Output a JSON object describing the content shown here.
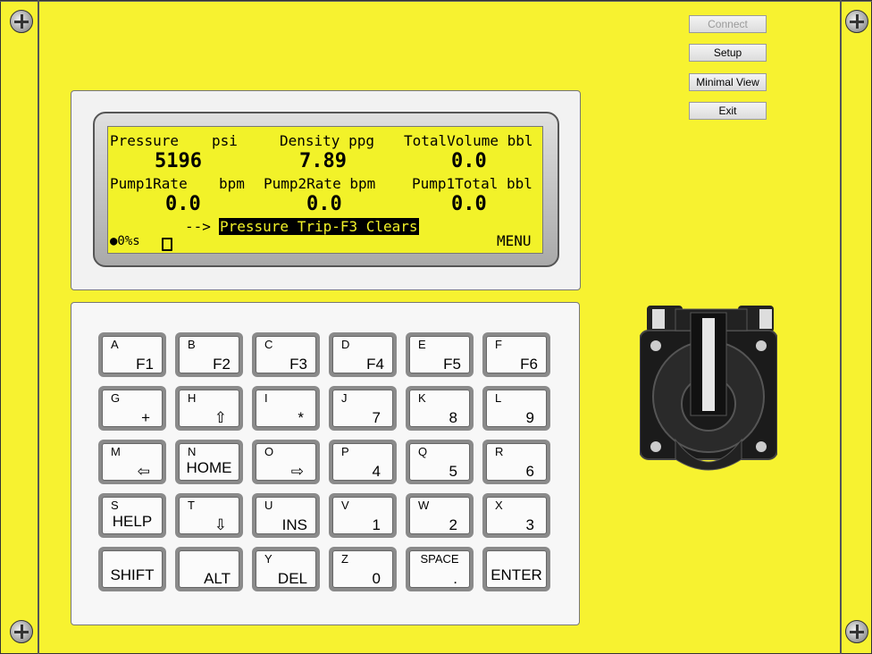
{
  "buttons": {
    "connect": "Connect",
    "setup": "Setup",
    "minimal_view": "Minimal View",
    "exit": "Exit"
  },
  "lcd": {
    "row1_labels": [
      "Pressure",
      "psi",
      "Density ppg",
      "TotalVolume bbl"
    ],
    "row1_values": [
      "5196",
      "7.89",
      "0.0"
    ],
    "row2_labels": [
      "Pump1Rate",
      "bpm",
      "Pump2Rate bpm",
      "Pump1Total bbl"
    ],
    "row2_values": [
      "0.0",
      "0.0",
      "0.0"
    ],
    "arrow": "-->",
    "message": "Pressure Trip-F3 Clears",
    "status": "●0%s",
    "menu": "MENU"
  },
  "keys": [
    [
      {
        "top": "A",
        "main": "F1"
      },
      {
        "top": "B",
        "main": "F2"
      },
      {
        "top": "C",
        "main": "F3"
      },
      {
        "top": "D",
        "main": "F4"
      },
      {
        "top": "E",
        "main": "F5"
      },
      {
        "top": "F",
        "main": "F6"
      }
    ],
    [
      {
        "top": "G",
        "main": "+"
      },
      {
        "top": "H",
        "main": "⇧"
      },
      {
        "top": "I",
        "main": "*"
      },
      {
        "top": "J",
        "main": "7"
      },
      {
        "top": "K",
        "main": "8"
      },
      {
        "top": "L",
        "main": "9"
      }
    ],
    [
      {
        "top": "M",
        "main": "⇦"
      },
      {
        "top": "N",
        "main": "HOME"
      },
      {
        "top": "O",
        "main": "⇨"
      },
      {
        "top": "P",
        "main": "4"
      },
      {
        "top": "Q",
        "main": "5"
      },
      {
        "top": "R",
        "main": "6"
      }
    ],
    [
      {
        "top": "S",
        "main": "HELP"
      },
      {
        "top": "T",
        "main": "⇩"
      },
      {
        "top": "U",
        "main": "INS"
      },
      {
        "top": "V",
        "main": "1"
      },
      {
        "top": "W",
        "main": "2"
      },
      {
        "top": "X",
        "main": "3"
      }
    ],
    [
      {
        "top": "",
        "main": "SHIFT"
      },
      {
        "top": "",
        "main": "ALT"
      },
      {
        "top": "Y",
        "main": "DEL"
      },
      {
        "top": "Z",
        "main": "0"
      },
      {
        "top": "SPACE",
        "main": "."
      },
      {
        "top": "",
        "main": "ENTER"
      }
    ]
  ]
}
